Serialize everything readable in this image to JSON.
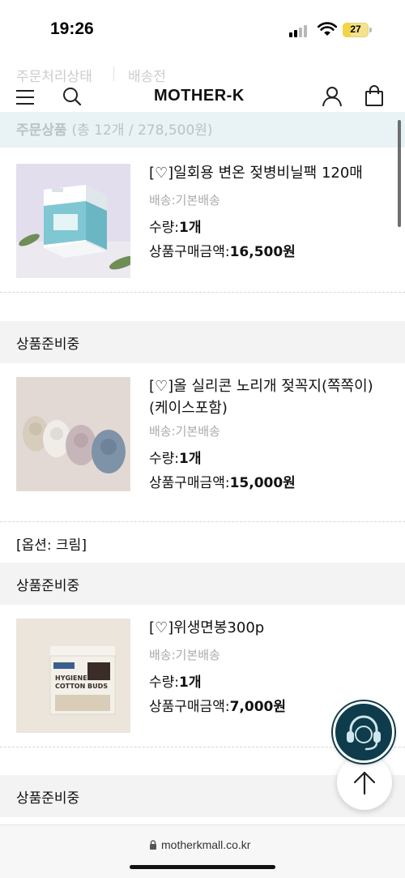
{
  "status_bar": {
    "time": "19:26",
    "battery": "27"
  },
  "behind_header": {
    "order_status_label": "주문처리상태",
    "order_status_value": "배송전"
  },
  "header": {
    "logo": "MOTHER-K"
  },
  "order_band": {
    "title": "주문상품",
    "summary": "(총 12개 / 278,500원)"
  },
  "products": [
    {
      "name": "[♡]일회용 변온 젖병비닐팩 120매",
      "shipping": "배송:기본배송",
      "qty_label": "수량:",
      "qty_value": "1개",
      "price_label": "상품구매금액:",
      "price_value": "16,500원",
      "image": "bottle-liner-box"
    },
    {
      "name": "[♡]올 실리콘 노리개 젖꼭지(쪽쪽이)(케이스포함)",
      "shipping": "배송:기본배송",
      "qty_label": "수량:",
      "qty_value": "1개",
      "price_label": "상품구매금액:",
      "price_value": "15,000원",
      "option": "[옵션: 크림]",
      "image": "silicone-pacifiers"
    },
    {
      "name": "[♡]위생면봉300p",
      "shipping": "배송:기본배송",
      "qty_label": "수량:",
      "qty_value": "1개",
      "price_label": "상품구매금액:",
      "price_value": "7,000원",
      "image": "cotton-buds-box"
    }
  ],
  "sections": [
    {
      "label": "상품준비중"
    },
    {
      "label": "상품준비중"
    },
    {
      "label": "상품준비중"
    }
  ],
  "url_bar": {
    "url": "motherkmall.co.kr"
  },
  "colors": {
    "band": "#e9f2f4",
    "section": "#f3f3f3",
    "chat": "#0e3c4c",
    "battery": "#f2d446"
  }
}
